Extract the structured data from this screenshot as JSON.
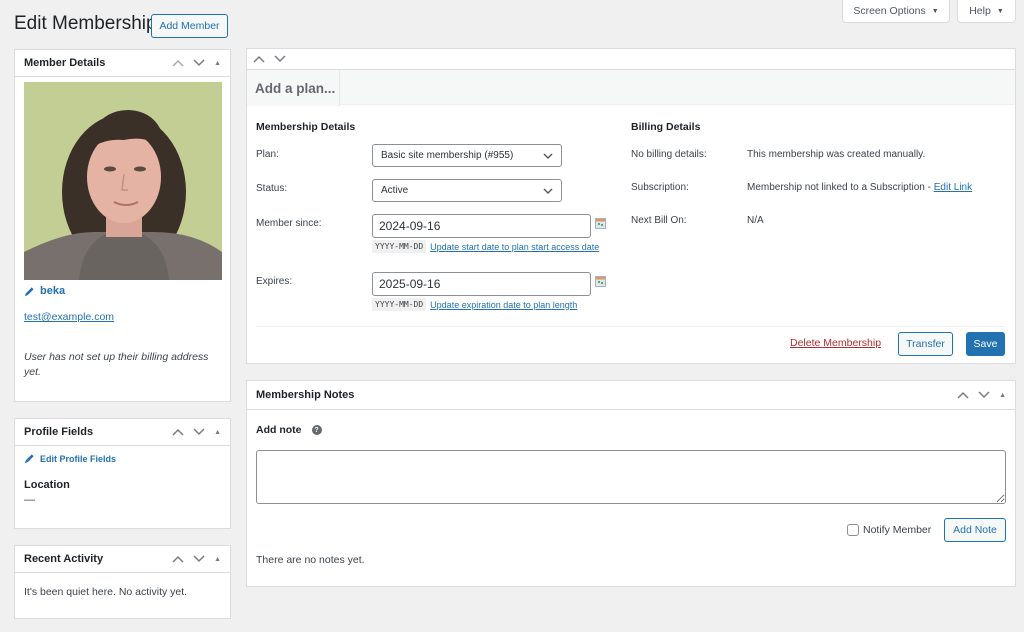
{
  "header": {
    "title": "Edit Membership",
    "add_member_label": "Add Member",
    "screen_options_label": "Screen Options",
    "help_label": "Help"
  },
  "member_details": {
    "title": "Member Details",
    "username": "beka",
    "email": "test@example.com",
    "billing_note": "User has not set up their billing address yet."
  },
  "profile_fields": {
    "title": "Profile Fields",
    "edit_link": "Edit Profile Fields",
    "fields": [
      {
        "label": "Location",
        "value": "—"
      }
    ]
  },
  "recent_activity": {
    "title": "Recent Activity",
    "empty_text": "It's been quiet here. No activity yet."
  },
  "plan_box": {
    "tab_label": "Add a plan...",
    "membership_details": {
      "title": "Membership Details",
      "plan_label": "Plan:",
      "plan_value": "Basic site membership (#955)",
      "status_label": "Status:",
      "status_value": "Active",
      "member_since_label": "Member since:",
      "member_since_value": "2024-09-16",
      "date_format": "YYYY-MM-DD",
      "update_start_link": "Update start date to plan start access date",
      "expires_label": "Expires:",
      "expires_value": "2025-09-16",
      "update_expiration_link": "Update expiration date to plan length"
    },
    "billing_details": {
      "title": "Billing Details",
      "no_billing_label": "No billing details:",
      "no_billing_value": "This membership was created manually.",
      "subscription_label": "Subscription:",
      "subscription_value": "Membership not linked to a Subscription - ",
      "subscription_link": "Edit Link",
      "next_bill_label": "Next Bill On:",
      "next_bill_value": "N/A"
    },
    "actions": {
      "delete_label": "Delete Membership",
      "transfer_label": "Transfer",
      "save_label": "Save"
    }
  },
  "notes": {
    "title": "Membership Notes",
    "add_note_label": "Add note",
    "note_value": "",
    "notify_label": "Notify Member",
    "notify_checked": false,
    "add_note_button": "Add Note",
    "empty_text": "There are no notes yet."
  }
}
